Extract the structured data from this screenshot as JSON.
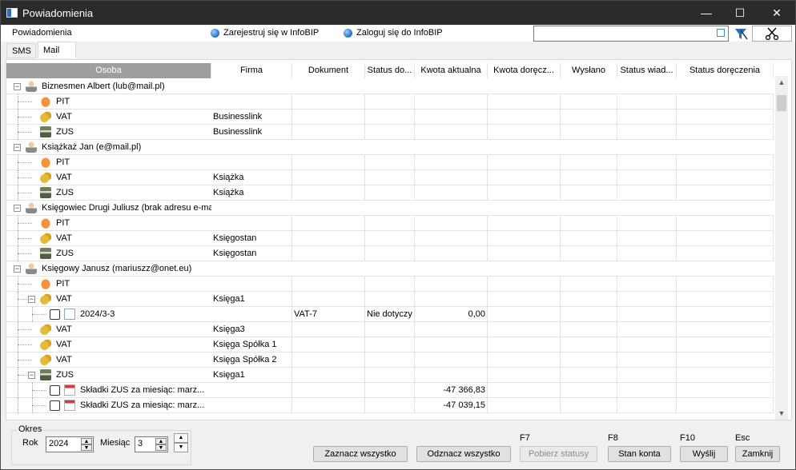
{
  "window": {
    "title": "Powiadomienia",
    "minimize": "—",
    "maximize": "☐",
    "close": "✕"
  },
  "menubar": {
    "label": "Powiadomienia",
    "register_link": "Zarejestruj się w InfoBIP",
    "login_link": "Zaloguj się do InfoBIP",
    "search_value": ""
  },
  "tabs": [
    {
      "label": "SMS"
    },
    {
      "label": "Mail"
    }
  ],
  "columns": [
    "Osoba",
    "Firma",
    "Dokument",
    "Status do...",
    "Kwota aktualna",
    "Kwota doręcz...",
    "Wysłano",
    "Status wiad...",
    "Status doręczenia"
  ],
  "rows": [
    {
      "level": 0,
      "type": "person",
      "expand": "−",
      "label": "Biznesmen Albert (lub@mail.pl)"
    },
    {
      "level": 1,
      "type": "pit",
      "label": "PIT",
      "firma": ""
    },
    {
      "level": 1,
      "type": "vat",
      "label": "VAT",
      "firma": "Businesslink"
    },
    {
      "level": 1,
      "type": "zus",
      "label": "ZUS",
      "firma": "Businesslink"
    },
    {
      "level": 0,
      "type": "person",
      "expand": "−",
      "label": "Książkaż Jan (e@mail.pl)"
    },
    {
      "level": 1,
      "type": "pit",
      "label": "PIT",
      "firma": ""
    },
    {
      "level": 1,
      "type": "vat",
      "label": "VAT",
      "firma": "Książka"
    },
    {
      "level": 1,
      "type": "zus",
      "label": "ZUS",
      "firma": "Książka"
    },
    {
      "level": 0,
      "type": "person",
      "expand": "−",
      "label": "Księgowiec Drugi Juliusz (brak adresu e-mail)"
    },
    {
      "level": 1,
      "type": "pit",
      "label": "PIT",
      "firma": ""
    },
    {
      "level": 1,
      "type": "vat",
      "label": "VAT",
      "firma": "Księgostan"
    },
    {
      "level": 1,
      "type": "zus",
      "label": "ZUS",
      "firma": "Księgostan"
    },
    {
      "level": 0,
      "type": "person",
      "expand": "−",
      "label": "Księgowy Janusz (mariuszz@onet.eu)"
    },
    {
      "level": 1,
      "type": "pit",
      "label": "PIT",
      "firma": ""
    },
    {
      "level": 1,
      "type": "vat",
      "expand": "−",
      "label": "VAT",
      "firma": "Księga1"
    },
    {
      "level": 2,
      "type": "doc",
      "check": true,
      "label": "2024/3-3",
      "firma": "",
      "dokument": "VAT-7",
      "status": "Nie dotyczy",
      "kwota": "0,00"
    },
    {
      "level": 1,
      "type": "vat",
      "label": "VAT",
      "firma": "Księga3"
    },
    {
      "level": 1,
      "type": "vat",
      "label": "VAT",
      "firma": "Księga Spółka 1"
    },
    {
      "level": 1,
      "type": "vat",
      "label": "VAT",
      "firma": "Księga Spółka 2"
    },
    {
      "level": 1,
      "type": "zus",
      "expand": "−",
      "label": "ZUS",
      "firma": "Księga1"
    },
    {
      "level": 2,
      "type": "docred",
      "check": true,
      "label": "Składki ZUS za miesiąc: marz...",
      "firma": "",
      "kwota": "-47 366,83"
    },
    {
      "level": 2,
      "type": "docred",
      "check": true,
      "label": "Składki ZUS za miesiąc: marz...",
      "firma": "",
      "kwota": "-47 039,15"
    }
  ],
  "okres": {
    "legend": "Okres",
    "rok_label": "Rok",
    "rok_value": "2024",
    "miesiac_label": "Miesiąc",
    "miesiac_value": "3"
  },
  "buttons": {
    "zaznacz": "Zaznacz wszystko",
    "odznacz": "Odznacz wszystko",
    "pobierz": "Pobierz statusy",
    "stan": "Stan konta",
    "wyslij": "Wyślij",
    "zamknij": "Zamknij"
  },
  "fkeys": {
    "pobierz": "F7",
    "stan": "F8",
    "wyslij": "F10",
    "zamknij": "Esc"
  }
}
